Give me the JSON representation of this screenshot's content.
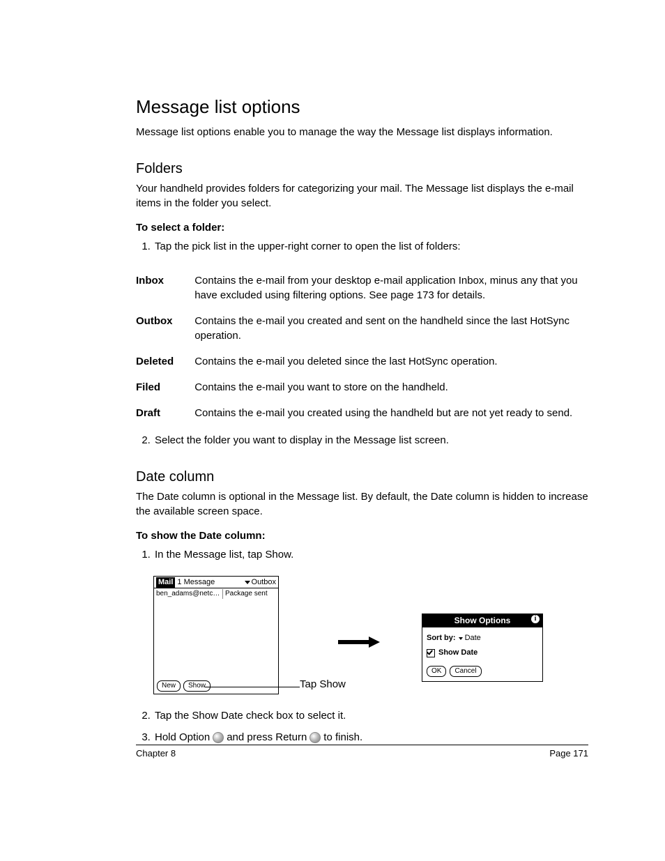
{
  "title": "Message list options",
  "intro": "Message list options enable you to manage the way the Message list displays information.",
  "folders": {
    "heading": "Folders",
    "desc": "Your handheld provides folders for categorizing your mail. The Message list displays the e-mail items in the folder you select.",
    "task": "To select a folder:",
    "step1": "Tap the pick list in the upper-right corner to open the list of folders:",
    "rows": [
      {
        "term": "Inbox",
        "def": "Contains the e-mail from your desktop e-mail application Inbox, minus any that you have excluded using filtering options. See page 173 for details."
      },
      {
        "term": "Outbox",
        "def": "Contains the e-mail you created and sent on the handheld since the last HotSync operation."
      },
      {
        "term": "Deleted",
        "def": "Contains the e-mail you deleted since the last HotSync operation."
      },
      {
        "term": "Filed",
        "def": "Contains the e-mail you want to store on the handheld."
      },
      {
        "term": "Draft",
        "def": "Contains the e-mail you created using the handheld but are not yet ready to send."
      }
    ],
    "step2": "Select the folder you want to display in the Message list screen."
  },
  "datecol": {
    "heading": "Date column",
    "desc": "The Date column is optional in the Message list. By default, the Date column is hidden to increase the available screen space.",
    "task": "To show the Date column:",
    "step1": "In the Message list, tap Show.",
    "step2": "Tap the Show Date check box to select it.",
    "step3a": "Hold Option",
    "step3b": "and press Return",
    "step3c": "to finish.",
    "tap_label": "Tap Show"
  },
  "mail": {
    "app": "Mail",
    "count": "1 Message",
    "folder": "Outbox",
    "row_from": "ben_adams@netc…",
    "row_subj": "Package sent",
    "btn_new": "New",
    "btn_show": "Show"
  },
  "options": {
    "title": "Show Options",
    "sort_label": "Sort by:",
    "sort_value": "Date",
    "check_label": "Show Date",
    "ok": "OK",
    "cancel": "Cancel"
  },
  "footer": {
    "left": "Chapter 8",
    "right": "Page 171"
  }
}
